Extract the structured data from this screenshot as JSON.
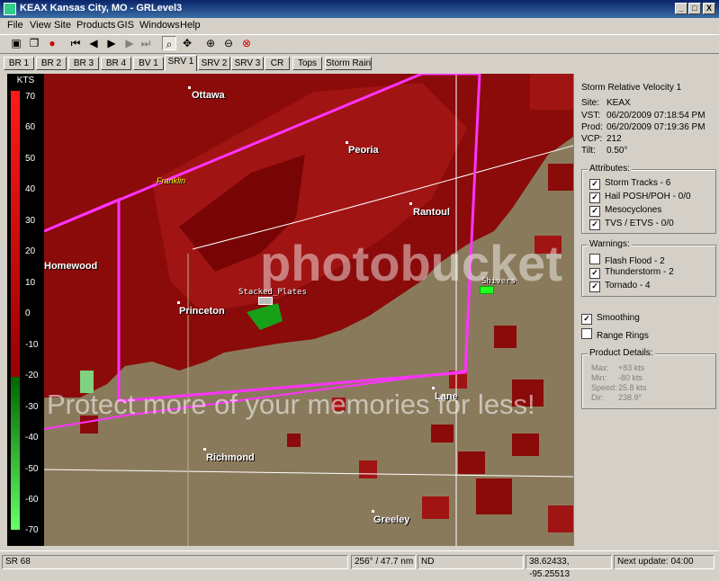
{
  "window": {
    "title": "KEAX Kansas City, MO - GRLevel3",
    "minimize": "_",
    "maximize": "□",
    "close": "X"
  },
  "menu": [
    "File",
    "View",
    "Site",
    "Products",
    "GIS",
    "Windows",
    "Help"
  ],
  "toolbar": {
    "icons": [
      "open-icon",
      "copy-icon",
      "record-icon",
      "first-frame-icon",
      "previous-frame-icon",
      "play-icon",
      "next-frame-icon",
      "last-frame-icon",
      "zoom-icon",
      "pan-icon",
      "zoom-in-icon",
      "zoom-out-icon",
      "zoom-reset-icon"
    ]
  },
  "tabs": [
    "BR 1",
    "BR 2",
    "BR 3",
    "BR 4",
    "BV 1",
    "SRV 1",
    "SRV 2",
    "SRV 3",
    "CR",
    "Tops",
    "Storm Rain"
  ],
  "active_tab": "SRV 1",
  "scale": {
    "unit": "KTS",
    "ticks": [
      "70",
      "60",
      "50",
      "40",
      "30",
      "20",
      "10",
      "0",
      "-10",
      "-20",
      "-30",
      "-40",
      "-50",
      "-60",
      "-70"
    ]
  },
  "map": {
    "cities": {
      "ottawa": "Ottawa",
      "peoria": "Peoria",
      "rantoul": "Rantoul",
      "homewood": "Homewood",
      "princeton": "Princeton",
      "lane": "Lane",
      "richmond": "Richmond",
      "greeley": "Greeley",
      "franklin": "Franklin"
    },
    "markers": {
      "stacked_plates": "Stacked_Plates",
      "shivers": "Shivers"
    },
    "watermark": {
      "logo": "photobucket",
      "text": "Protect more of your memories for less!"
    }
  },
  "product": {
    "name": "Storm Relative Velocity 1",
    "site_label": "Site:",
    "site": "KEAX",
    "vst_label": "VST:",
    "vst": "06/20/2009  07:18:54 PM",
    "prod_label": "Prod:",
    "prod": "06/20/2009  07:19:36 PM",
    "vcp_label": "VCP:",
    "vcp": "212",
    "tilt_label": "Tilt:",
    "tilt": "0.50°"
  },
  "attributes": {
    "title": "Attributes:",
    "items": [
      {
        "label": "Storm Tracks - 6",
        "checked": true
      },
      {
        "label": "Hail POSH/POH - 0/0",
        "checked": true
      },
      {
        "label": "Mesocyclones",
        "checked": true
      },
      {
        "label": "TVS / ETVS - 0/0",
        "checked": true
      }
    ]
  },
  "warnings": {
    "title": "Warnings:",
    "items": [
      {
        "label": "Flash Flood - 2",
        "checked": false
      },
      {
        "label": "Thunderstorm - 2",
        "checked": true
      },
      {
        "label": "Tornado - 4",
        "checked": true
      }
    ]
  },
  "options": {
    "smoothing": {
      "label": "Smoothing",
      "checked": true
    },
    "range_rings": {
      "label": "Range Rings",
      "checked": false
    }
  },
  "details": {
    "title": "Product Details:",
    "max_label": "Max:",
    "max": "+83 kts",
    "min_label": "Min:",
    "min": "-80 kts",
    "speed_label": "Speed:",
    "speed": "25.8 kts",
    "dir_label": "Dir:",
    "dir": "238.9°"
  },
  "status": {
    "product": "SR 68",
    "bearing": "256° / 47.7 nm",
    "nd": "ND",
    "coords": "38.62433, -95.25513",
    "next_update": "Next update: 04:00"
  },
  "colors": {
    "velocity_red": "#8b0a0a",
    "velocity_green": "#19a019",
    "warning_magenta": "#ff33ff",
    "terrain": "#8a7a5c"
  }
}
